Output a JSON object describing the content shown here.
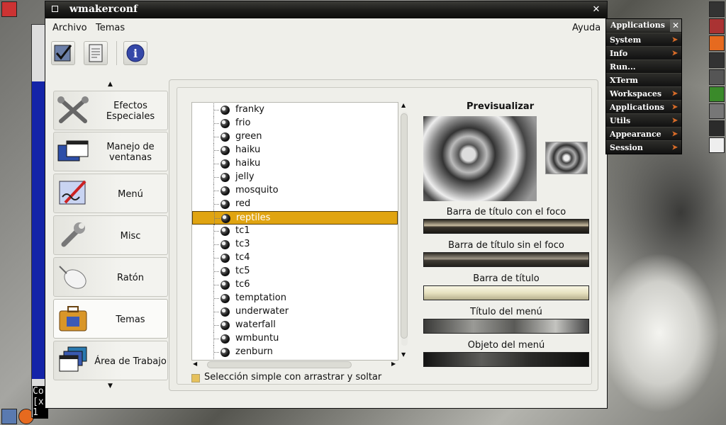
{
  "window": {
    "title": "wmakerconf"
  },
  "menubar": {
    "archivo": "Archivo",
    "temas": "Temas",
    "ayuda": "Ayuda"
  },
  "categories": [
    {
      "label": "Efectos Especiales",
      "icon": "tools-icon"
    },
    {
      "label": "Manejo de ventanas",
      "icon": "windows-icon"
    },
    {
      "label": "Menú",
      "icon": "menu-edit-icon"
    },
    {
      "label": "Misc",
      "icon": "wrench-icon"
    },
    {
      "label": "Ratón",
      "icon": "mouse-icon"
    },
    {
      "label": "Temas",
      "icon": "briefcase-icon"
    },
    {
      "label": "Área de Trabajo",
      "icon": "workspace-icon"
    }
  ],
  "themes": [
    "franky",
    "frio",
    "green",
    "haiku",
    "haiku",
    "jelly",
    "mosquito",
    "red",
    "reptiles",
    "tc1",
    "tc3",
    "tc4",
    "tc5",
    "tc6",
    "temptation",
    "underwater",
    "waterfall",
    "wmbuntu",
    "zenburn"
  ],
  "selected_theme": "reptiles",
  "checkbox": {
    "label": "Selección simple con arrastrar y soltar",
    "checked": true
  },
  "preview": {
    "title": "Previsualizar",
    "labels": [
      "Barra de título con el foco",
      "Barra de título sin el foco",
      "Barra de título",
      "Título del menú",
      "Objeto del menú"
    ]
  },
  "appmenu": {
    "title": "Applications",
    "items": [
      {
        "label": "System",
        "submenu": true
      },
      {
        "label": "Info",
        "submenu": true
      },
      {
        "label": "Run...",
        "submenu": false
      },
      {
        "label": "XTerm",
        "submenu": false
      },
      {
        "label": "Workspaces",
        "submenu": true
      },
      {
        "label": "Applications",
        "submenu": true
      },
      {
        "label": "Utils",
        "submenu": true
      },
      {
        "label": "Appearance",
        "submenu": true
      },
      {
        "label": "Session",
        "submenu": true
      }
    ]
  },
  "background_terminal": {
    "text_lines": [
      "Co",
      "[x",
      "1"
    ]
  },
  "colors": {
    "selection": "#e0a411",
    "terminal": "#1424a8"
  }
}
